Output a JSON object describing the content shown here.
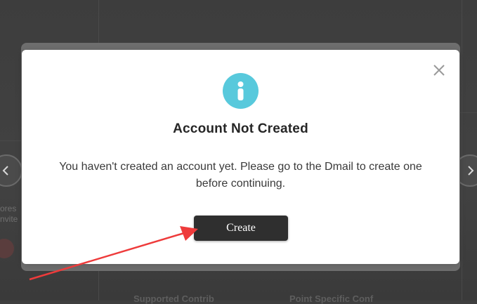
{
  "background": {
    "snippet_left_1": "ores",
    "snippet_left_2": "nvite",
    "snippet_bottom_1": "Supported Contrib",
    "snippet_bottom_2": "Point Specific Conf"
  },
  "carousel": {
    "prev_icon": "chevron-left-icon",
    "next_icon": "chevron-right-icon"
  },
  "modal": {
    "icon": "info-icon",
    "icon_color": "#58c9dc",
    "title": "Account Not Created",
    "message": "You haven't created an account yet. Please go to the Dmail to create one before continuing.",
    "create_label": "Create",
    "close_icon": "close-icon"
  },
  "annotation": {
    "arrow_color": "#ee3b3b"
  }
}
